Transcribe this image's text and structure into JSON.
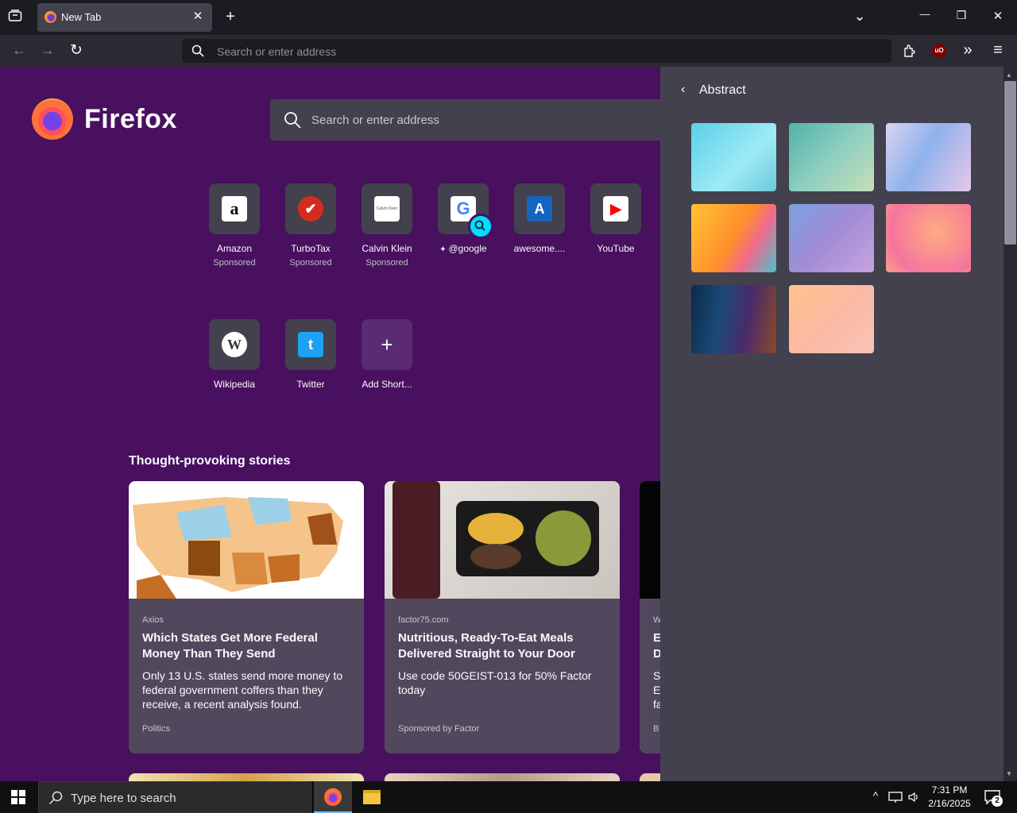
{
  "tabbar": {
    "tab_title": "New Tab",
    "close_glyph": "✕",
    "new_tab_glyph": "+",
    "list_all_glyph": "⌄",
    "min_glyph": "—",
    "restore_glyph": "❐",
    "close_win_glyph": "✕"
  },
  "navbar": {
    "back_glyph": "←",
    "forward_glyph": "→",
    "reload_glyph": "↻",
    "url_placeholder": "Search or enter address",
    "overflow_glyph": "»",
    "menu_glyph": "≡",
    "ublock_label": "uO"
  },
  "newtab": {
    "brand": "Firefox",
    "search_placeholder": "Search or enter address",
    "shortcuts": [
      {
        "label": "Amazon",
        "sub": "Sponsored",
        "glyph": "a",
        "icon": "amazon-icon"
      },
      {
        "label": "TurboTax",
        "sub": "Sponsored",
        "glyph": "✔",
        "icon": "turbotax-icon"
      },
      {
        "label": "Calvin Klein",
        "sub": "Sponsored",
        "glyph": "Calvin Klein",
        "icon": "calvin-klein-icon"
      },
      {
        "label": "@google",
        "sub": "",
        "glyph": "G",
        "icon": "google-icon"
      },
      {
        "label": "awesome....",
        "sub": "",
        "glyph": "A",
        "icon": "awesome-icon"
      },
      {
        "label": "YouTube",
        "sub": "",
        "glyph": "▶",
        "icon": "youtube-icon"
      },
      {
        "label": "Wikipedia",
        "sub": "",
        "glyph": "W",
        "icon": "wikipedia-icon"
      },
      {
        "label": "Twitter",
        "sub": "",
        "glyph": "t",
        "icon": "twitter-icon"
      },
      {
        "label": "Add Short...",
        "sub": "",
        "glyph": "+",
        "icon": "add-shortcut-icon"
      }
    ],
    "section_title": "Thought-provoking stories",
    "cards": [
      {
        "source": "Axios",
        "title": "Which States Get More Federal Money Than They Send",
        "desc": "Only 13 U.S. states send more money to federal government coffers than they receive, a recent analysis found.",
        "foot": "Politics"
      },
      {
        "source": "factor75.com",
        "title": "Nutritious, Ready-To-Eat Meals Delivered Straight to Your Door",
        "desc": "Use code 50GEIST-013 for 50% Factor today",
        "foot": "Sponsored by Factor"
      },
      {
        "source": "W",
        "title": "E D",
        "desc": "S E fa",
        "foot": "B"
      }
    ]
  },
  "panel": {
    "back_glyph": "‹",
    "title": "Abstract"
  },
  "taskbar": {
    "search_placeholder": "Type here to search",
    "time": "7:31 PM",
    "date": "2/16/2025",
    "notif_count": "2"
  }
}
